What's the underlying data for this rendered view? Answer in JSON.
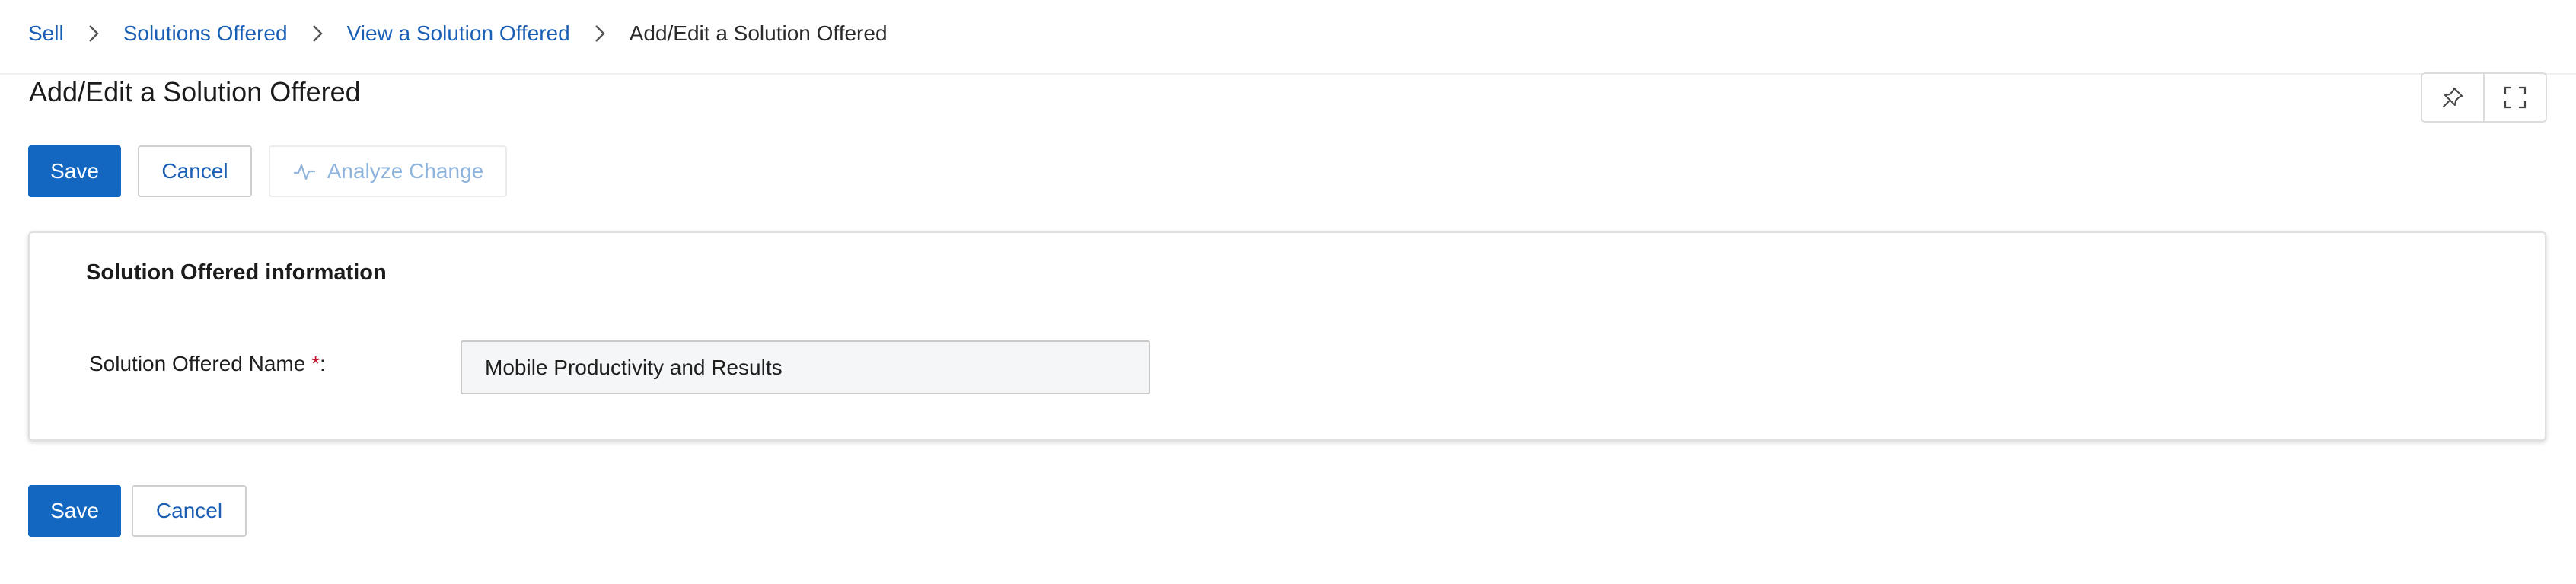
{
  "breadcrumb": {
    "items": [
      {
        "label": "Sell"
      },
      {
        "label": "Solutions Offered"
      },
      {
        "label": "View a Solution Offered"
      },
      {
        "label": "Add/Edit a Solution Offered"
      }
    ]
  },
  "page": {
    "title": "Add/Edit a Solution Offered"
  },
  "header_icons": {
    "pin": "pin-icon",
    "fullscreen": "fullscreen-icon"
  },
  "top_actions": {
    "save_label": "Save",
    "cancel_label": "Cancel",
    "analyze_label": "Analyze Change"
  },
  "section": {
    "title": "Solution Offered information",
    "field": {
      "label": "Solution Offered Name",
      "required_mark": "*",
      "suffix": ":",
      "value": "Mobile Productivity and Results"
    }
  },
  "bottom_actions": {
    "save_label": "Save",
    "cancel_label": "Cancel"
  },
  "colors": {
    "primary": "#1467c0",
    "link": "#1a5fb4",
    "required": "#c8102e",
    "disabled_text": "#8fb4dc"
  }
}
